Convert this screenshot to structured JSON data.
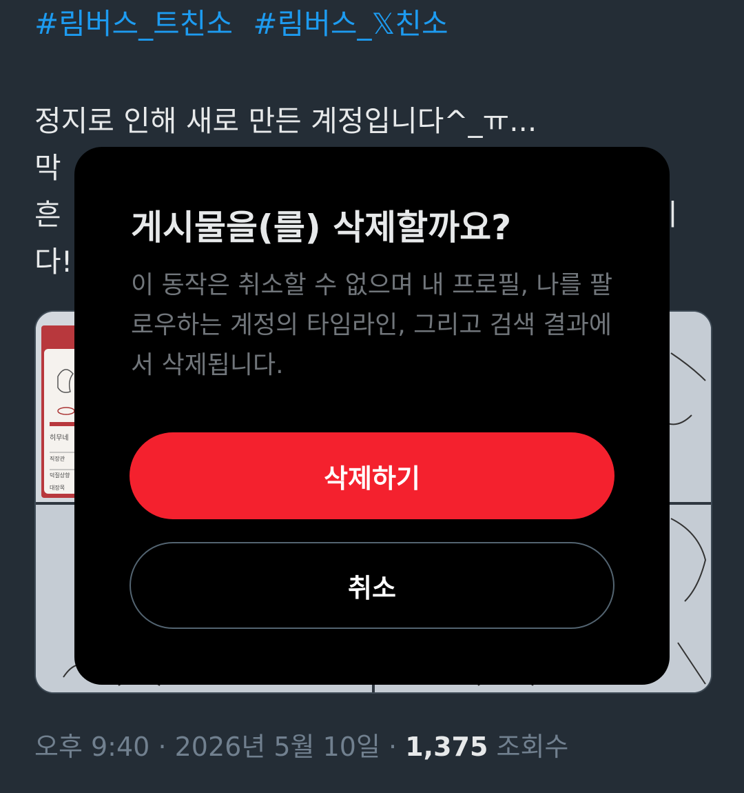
{
  "tweet": {
    "hashtags": [
      "#림버스_트친소",
      "#림버스_𝕏친소"
    ],
    "body_lines": [
      "정지로 인해 새로 만든 계정입니다^_ㅠ...",
      "막",
      "흔",
      "다!"
    ],
    "partial_text_right": "니",
    "meta": {
      "time": "오후 9:40",
      "separator": "·",
      "date": "2026년 5월 10일",
      "views_count": "1,375",
      "views_label": "조회수"
    }
  },
  "media": {
    "thumb_labels": [
      "히무네",
      "직장관",
      "덕질상향",
      "대장목"
    ]
  },
  "dialog": {
    "title": "게시물을(를) 삭제할까요?",
    "description": "이 동작은 취소할 수 없으며 내 프로필, 나를 팔로우하는 계정의 타임라인, 그리고 검색 결과에서 삭제됩니다.",
    "delete_label": "삭제하기",
    "cancel_label": "취소"
  },
  "colors": {
    "background": "#242d36",
    "link": "#1d9bf0",
    "danger": "#f4212e",
    "dialog_bg": "#000000"
  }
}
